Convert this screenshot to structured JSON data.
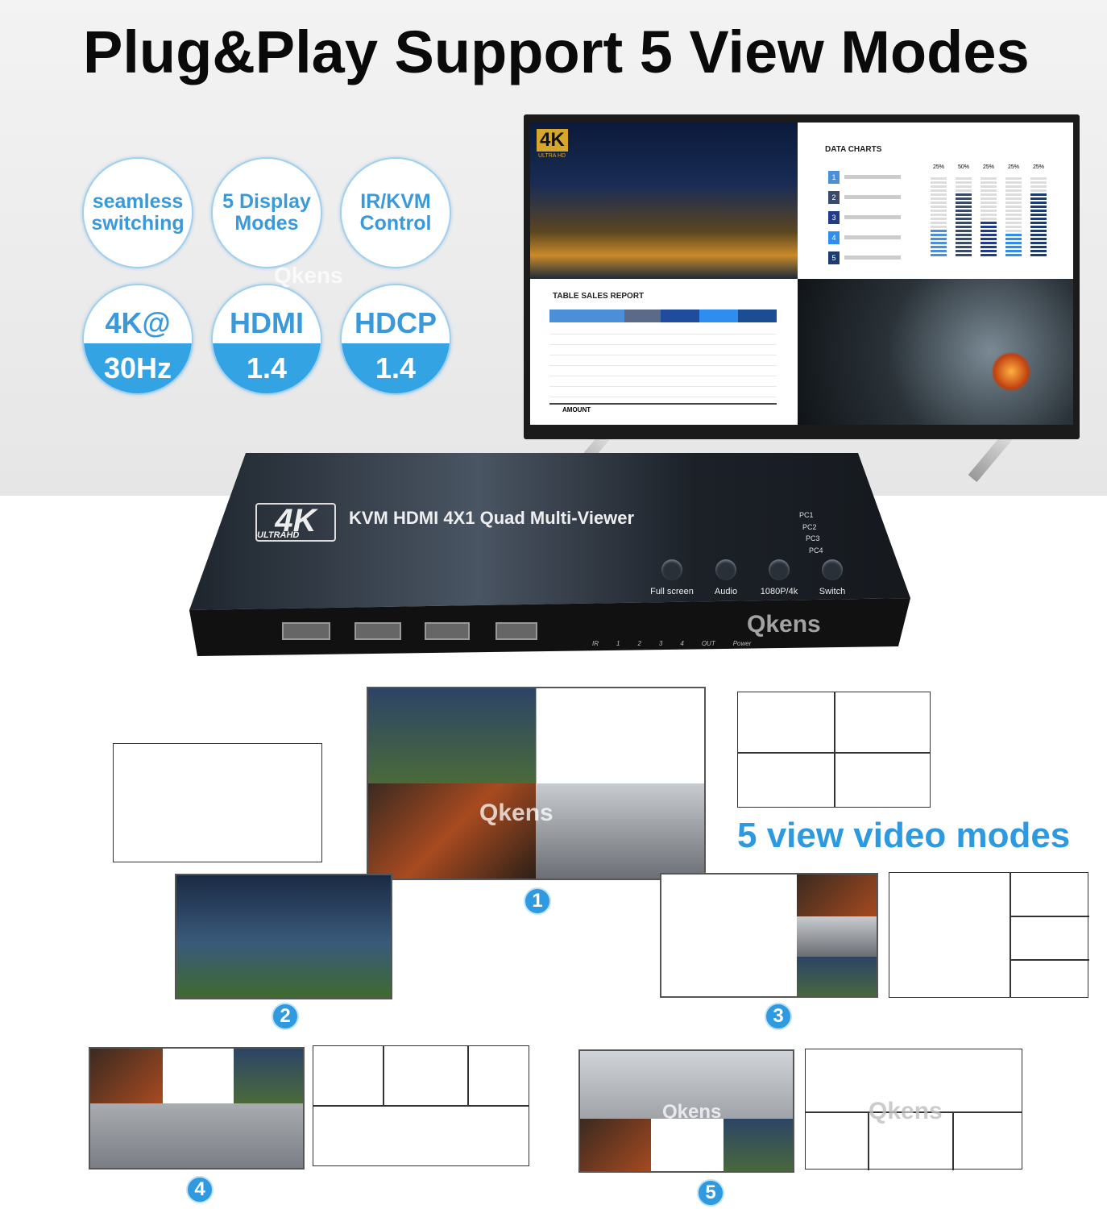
{
  "title": "Plug&Play Support 5 View Modes",
  "badges": [
    {
      "text": "seamless switching"
    },
    {
      "text": "5 Display Modes"
    },
    {
      "text": "IR/KVM Control"
    },
    {
      "top": "4K@",
      "bottom": "30Hz"
    },
    {
      "top": "HDMI",
      "bottom": "1.4"
    },
    {
      "top": "HDCP",
      "bottom": "1.4"
    }
  ],
  "watermark": "Qkens",
  "tv": {
    "logo": "4K",
    "logo_sub": "ULTRA HD",
    "chart_title": "DATA CHARTS",
    "chart_items": [
      "1",
      "2",
      "3",
      "4",
      "5"
    ],
    "chart_percents": [
      "25%",
      "50%",
      "25%",
      "25%",
      "25%"
    ],
    "chart_fill": [
      0.35,
      0.8,
      0.45,
      0.3,
      0.8
    ],
    "table_title": "TABLE SALES REPORT",
    "table_total": "AMOUNT"
  },
  "device": {
    "logo": "4K",
    "logo_sub": "ULTRAHD",
    "name": "KVM HDMI 4X1 Quad Multi-Viewer",
    "leds": [
      "PC1",
      "PC2",
      "PC3",
      "PC4"
    ],
    "buttons": [
      "Full screen",
      "Audio",
      "1080P/4k",
      "Switch"
    ],
    "port_labels": [
      "IR",
      "1",
      "2",
      "3",
      "4",
      "OUT",
      "Power"
    ]
  },
  "modes_heading": "5 view video modes",
  "mode_numbers": [
    "1",
    "2",
    "3",
    "4",
    "5"
  ],
  "colors": {
    "accent": "#2d9ae0",
    "badge_text": "#3a9ad9",
    "device": "#1e2328"
  }
}
